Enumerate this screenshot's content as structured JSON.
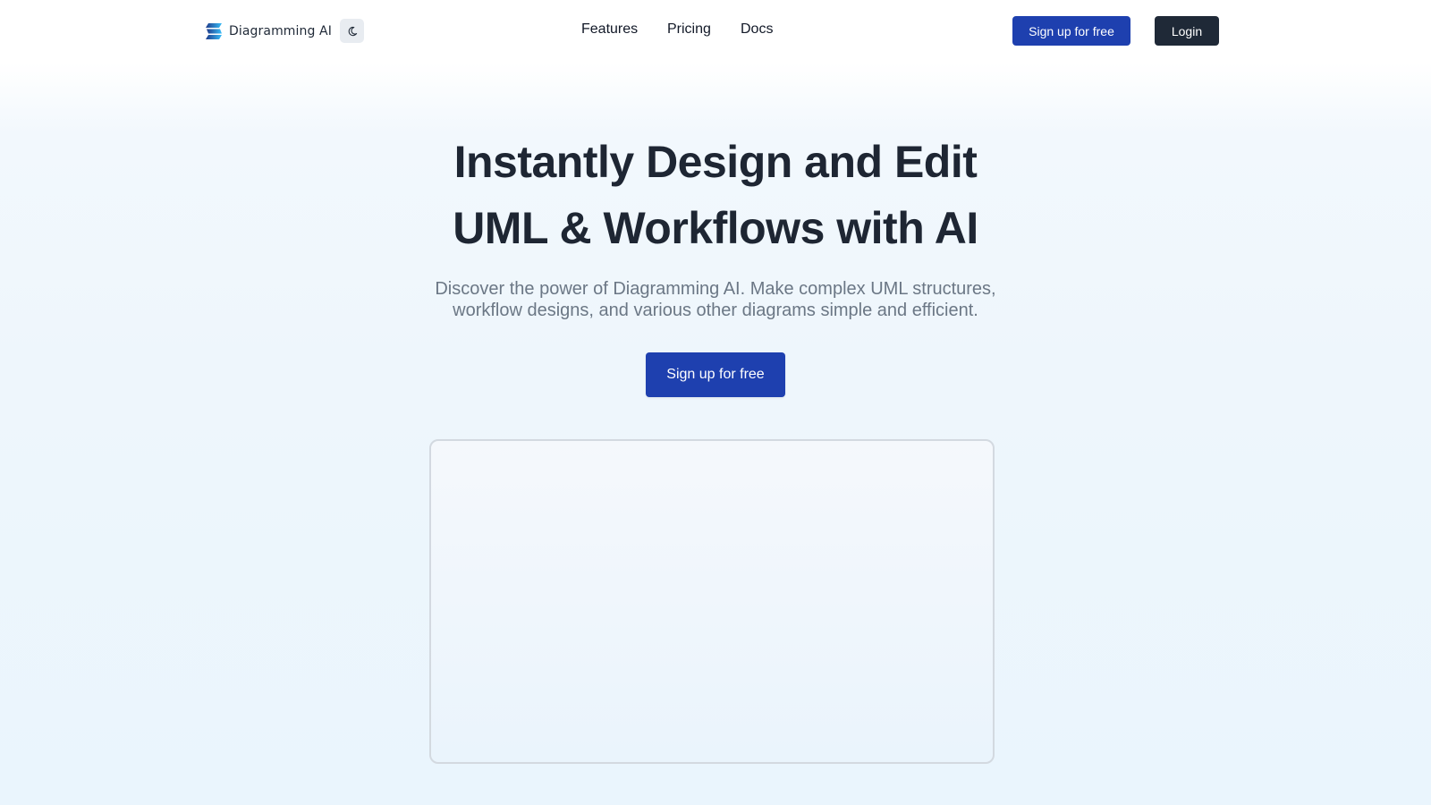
{
  "brand": {
    "name": "Diagramming AI",
    "logo_icon": "stacked-chevron-logo",
    "colors": [
      "#1e3a8a",
      "#38bdf8"
    ]
  },
  "theme_toggle": {
    "icon": "moon-icon"
  },
  "nav": {
    "links": [
      {
        "label": "Features"
      },
      {
        "label": "Pricing"
      },
      {
        "label": "Docs"
      }
    ],
    "signup_label": "Sign up for free",
    "login_label": "Login"
  },
  "hero": {
    "title_line1": "Instantly Design and Edit",
    "title_line2": "UML & Workflows with AI",
    "subtitle_line1": "Discover the power of Diagramming AI. Make complex UML structures,",
    "subtitle_line2": "workflow designs, and various other diagrams simple and efficient.",
    "cta_label": "Sign up for free"
  },
  "colors": {
    "primary": "#1e40af",
    "dark": "#1f2937",
    "text_muted": "#6b7785"
  }
}
